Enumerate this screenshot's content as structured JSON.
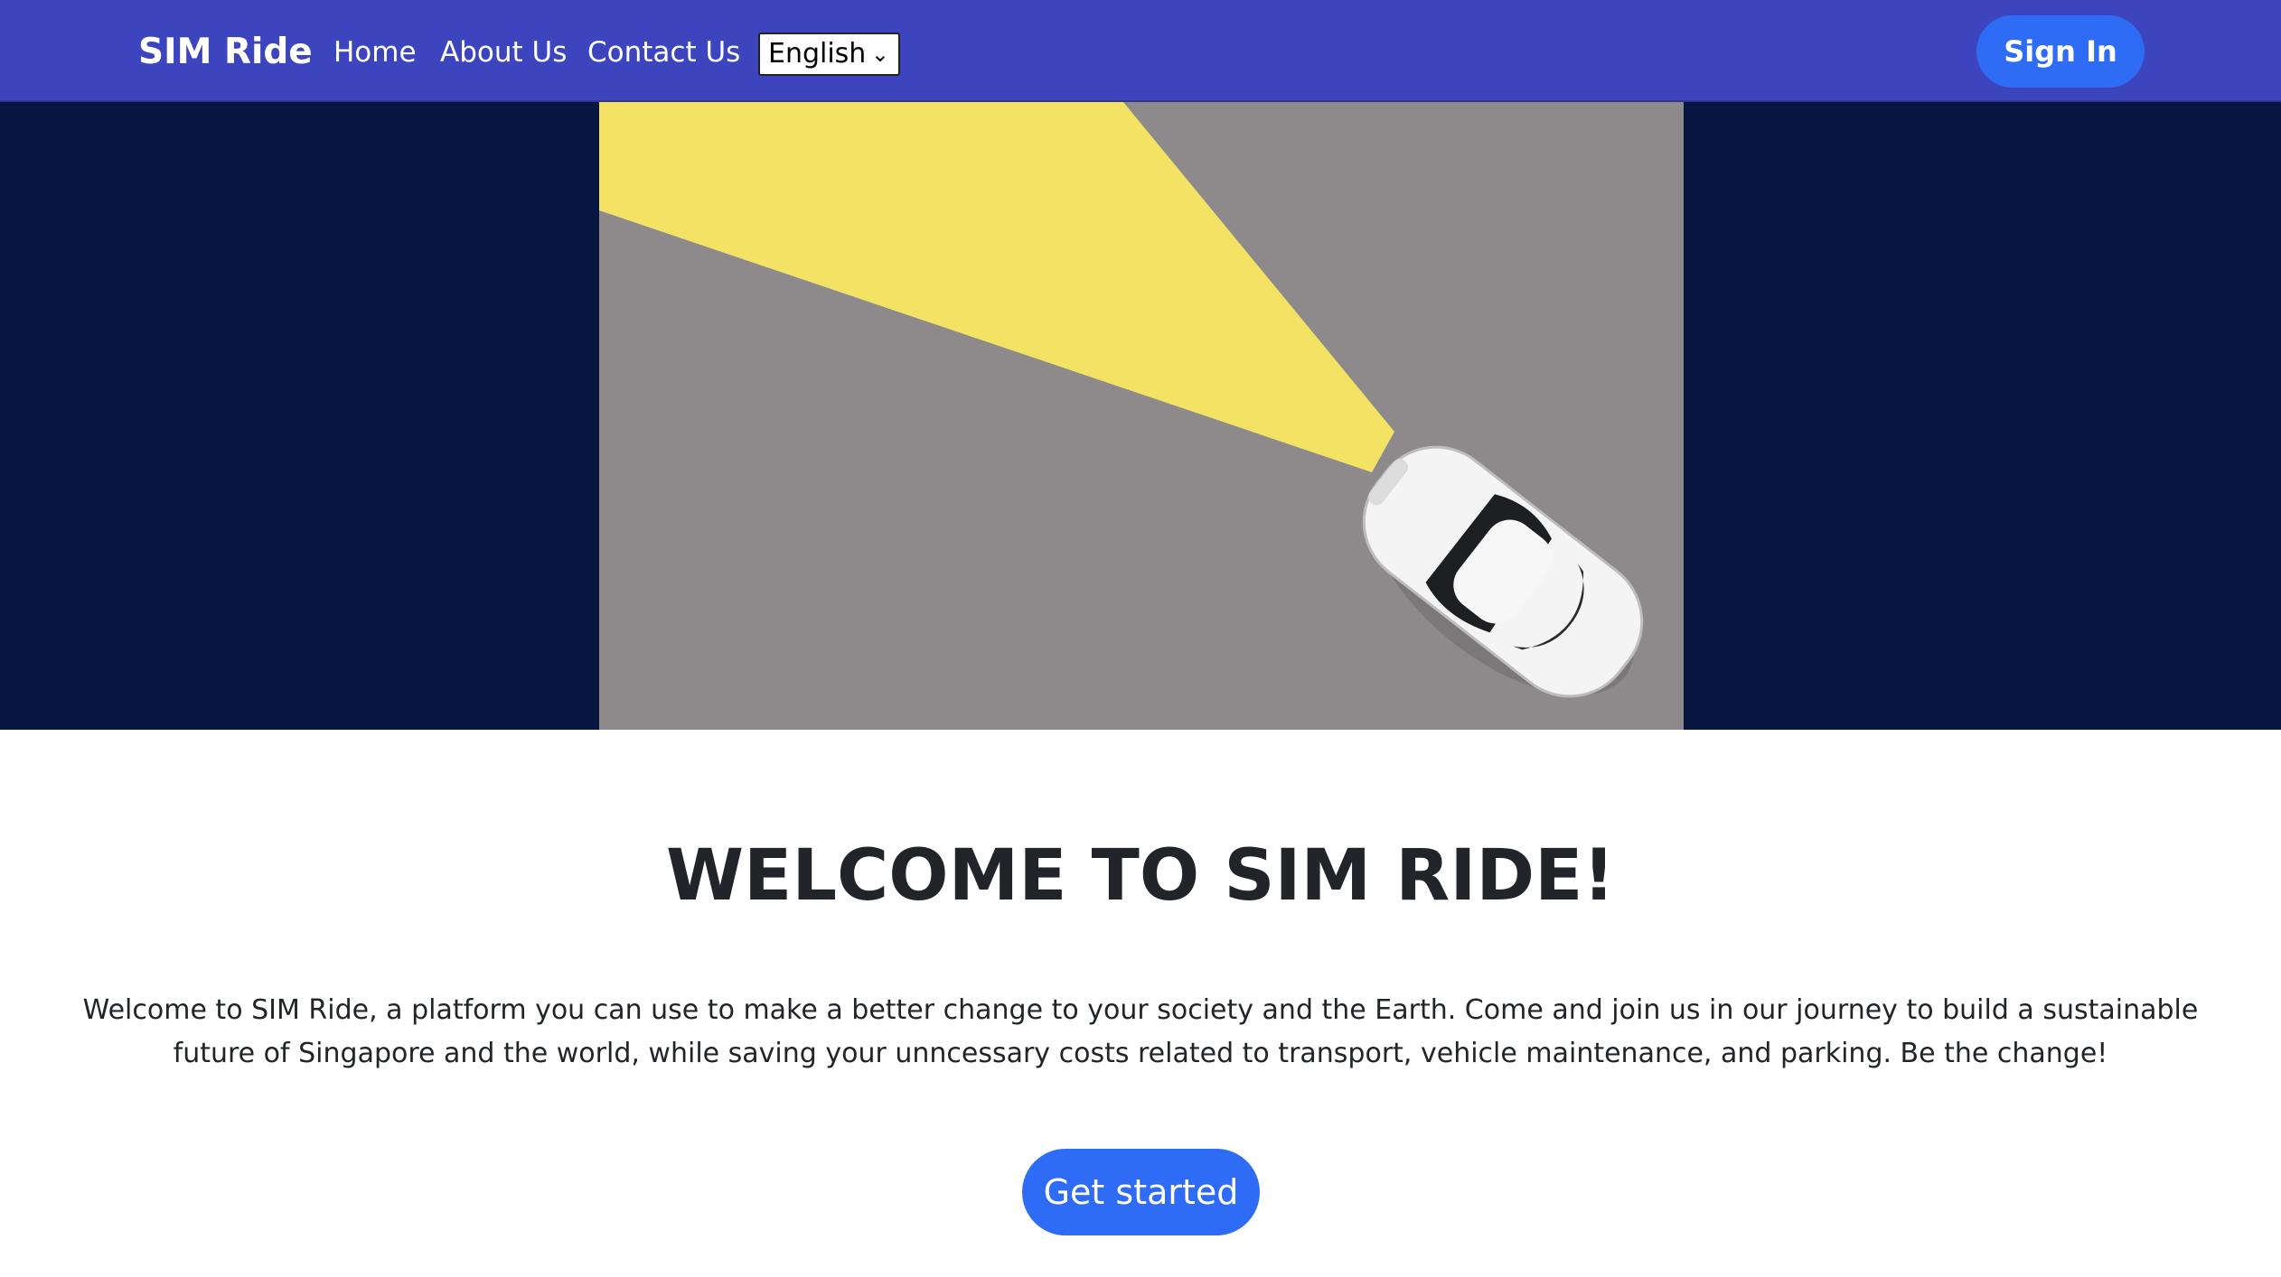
{
  "navbar": {
    "brand": "SIM Ride",
    "links": [
      "Home",
      "About Us",
      "Contact Us"
    ],
    "language": {
      "selected": "English"
    },
    "sign_in": "Sign In"
  },
  "hero": {
    "image_description": "toy-car-headlight-illustration"
  },
  "main": {
    "title": "WELCOME TO SIM RIDE!",
    "description": "Welcome to SIM Ride, a platform you can use to make a better change to your society and the Earth. Come and join us in our journey to build a sustainable future of Singapore and the world, while saving your unncessary costs related to transport, vehicle maintenance, and parking. Be the change!",
    "cta": "Get started"
  },
  "colors": {
    "navbar": "#3c45bd",
    "hero_bg": "#061640",
    "accent": "#2f6cf5",
    "text": "#212529"
  }
}
